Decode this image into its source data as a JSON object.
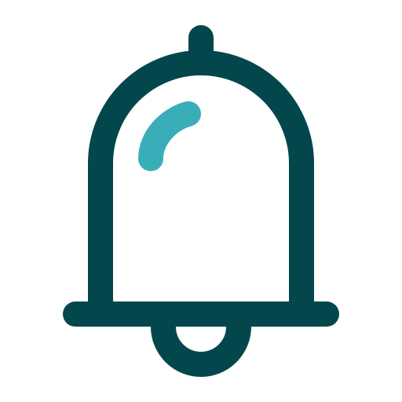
{
  "icon": {
    "name": "bell-icon",
    "colors": {
      "outline": "#03474D",
      "highlight": "#3AAEB8",
      "background": "#FFFFFF"
    }
  }
}
